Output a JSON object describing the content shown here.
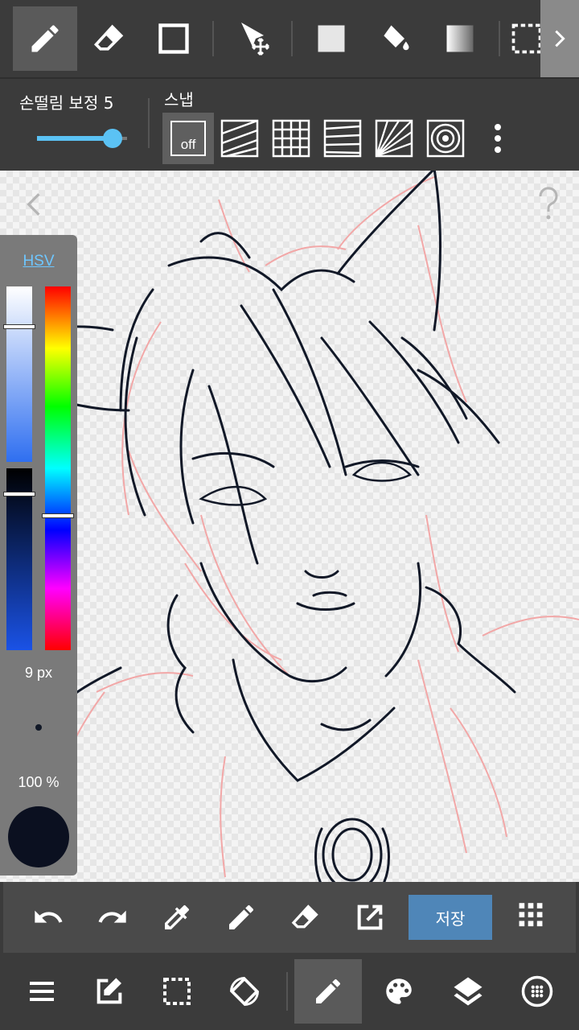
{
  "toolbar": {
    "tools": [
      {
        "name": "pen",
        "icon": "pen-icon",
        "active": true
      },
      {
        "name": "eraser",
        "icon": "eraser-icon"
      },
      {
        "name": "shape",
        "icon": "square-outline-icon"
      },
      {
        "name": "move",
        "icon": "move-cursor-icon"
      },
      {
        "name": "fill-color",
        "icon": "filled-square-icon"
      },
      {
        "name": "bucket",
        "icon": "paint-bucket-icon"
      },
      {
        "name": "gradient",
        "icon": "gradient-icon"
      },
      {
        "name": "select",
        "icon": "dashed-select-icon"
      }
    ]
  },
  "options": {
    "stabilizer_label": "손떨림 보정 5",
    "stabilizer_value": 5,
    "stabilizer_fraction": 0.93,
    "snap_label": "스냅",
    "snap_off_label": "off",
    "snaps": [
      "off",
      "diagonal-lines",
      "grid",
      "horizontal-lines",
      "radial",
      "concentric"
    ]
  },
  "canvas": {
    "help_icon": "question-icon",
    "back_icon": "chevron-left-icon"
  },
  "color_panel": {
    "mode_label": "HSV",
    "brush_size": "9 px",
    "opacity": "100 %",
    "saturation_level": 0.23,
    "value_level": 0.14,
    "hue_level": 0.63,
    "current_color": "#0b1020"
  },
  "actions": {
    "save_label": "저장",
    "items": [
      "undo-icon",
      "redo-icon",
      "eyedropper-icon",
      "pen-icon",
      "eraser-icon",
      "export-icon",
      "save-button",
      "grid-menu-icon"
    ]
  },
  "bottom_nav": {
    "items": [
      "menu-icon",
      "edit-icon",
      "select-icon",
      "rotate-icon",
      "brush-icon",
      "palette-icon",
      "layers-icon",
      "material-icon"
    ]
  },
  "colors": {
    "accent": "#5bc2f4",
    "save_bg": "#4f86b8",
    "toolbar_bg": "#3b3b3b"
  }
}
